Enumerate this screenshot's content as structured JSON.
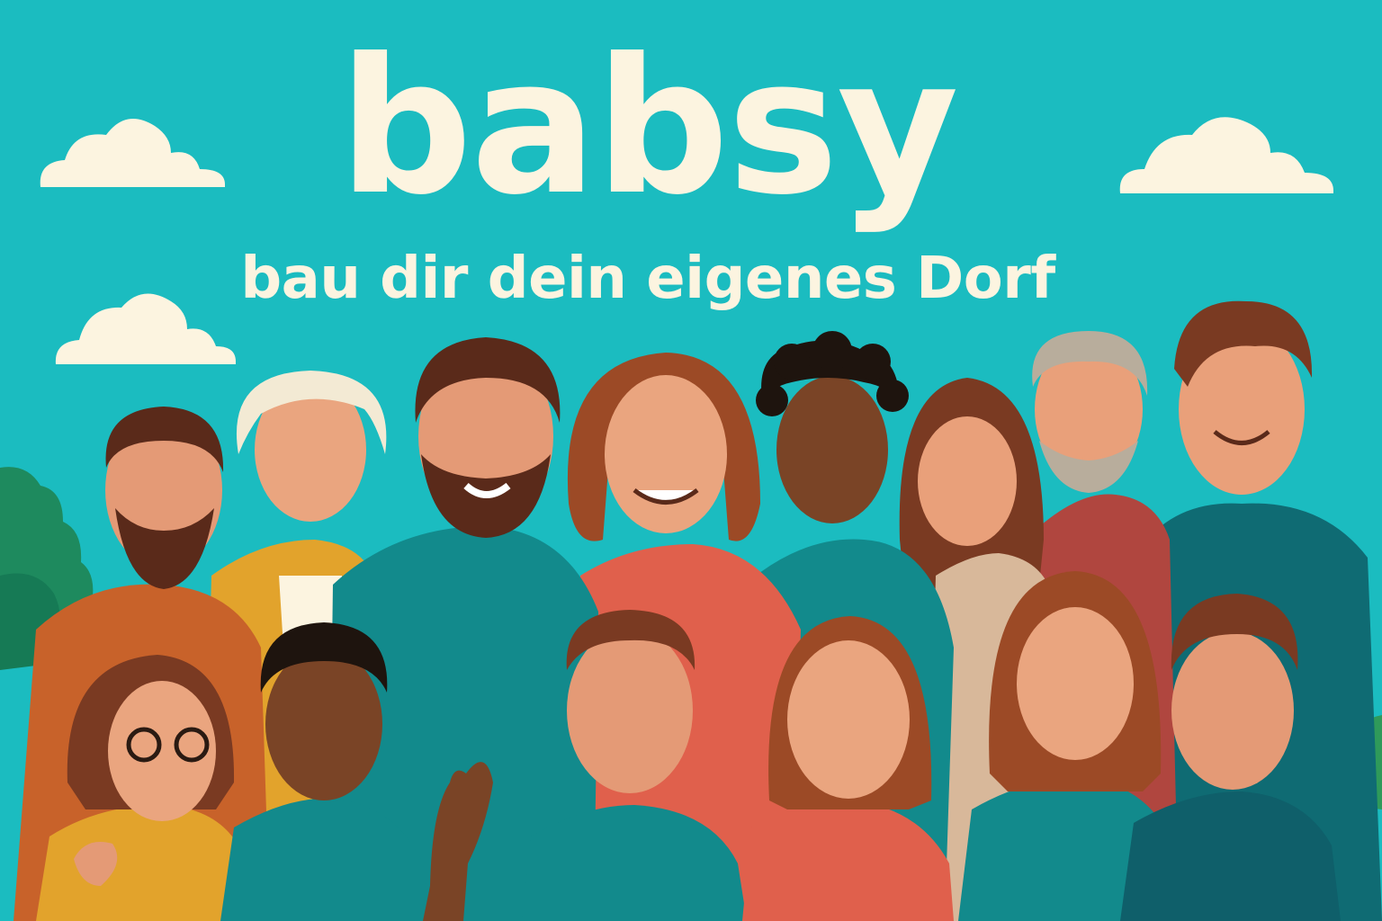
{
  "poster": {
    "brand": "babsy",
    "tagline": "bau dir dein eigenes Dorf"
  },
  "illustration": {
    "subject": "group-of-people",
    "icons": [
      "cloud-icon",
      "tree-icon"
    ]
  },
  "colors": {
    "sky": "#1bbcc0",
    "text": "#fcf4e0",
    "cloud": "#fcf4e0",
    "tree_dark": "#1e8a5e",
    "tree_light": "#2f9a5a",
    "teal_shirt": "#128a8c",
    "coral_shirt": "#e0604c",
    "mustard": "#e2a32c",
    "rust": "#c8622a"
  }
}
